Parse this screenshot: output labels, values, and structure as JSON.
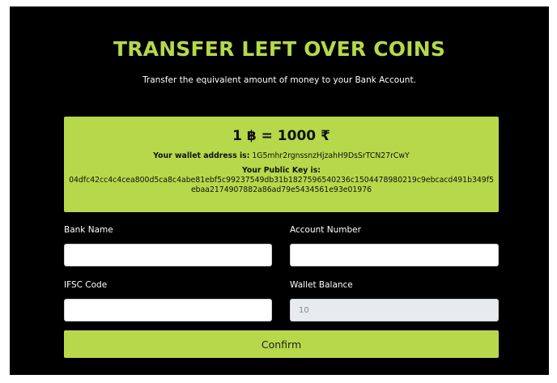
{
  "page": {
    "title": "TRANSFER LEFT OVER COINS",
    "subtitle": "Transfer the equivalent amount of money to your Bank Account."
  },
  "info": {
    "rate": "1 ฿ = 1000 ₹",
    "wallet_label": "Your wallet address is:",
    "wallet_address": "1G5mhr2rgnssnzHjzahH9DsSrTCN27rCwY",
    "public_key_label": "Your Public Key is:",
    "public_key": "04dfc42cc4c4cea800d5ca8c4abe81ebf5c99237549db31b1827596540236c1504478980219c9ebcacd491b349f5ebaa2174907882a86ad79e5434561e93e01976"
  },
  "form": {
    "bank_name_label": "Bank Name",
    "bank_name_value": "",
    "account_number_label": "Account Number",
    "account_number_value": "",
    "ifsc_label": "IFSC Code",
    "ifsc_value": "",
    "wallet_balance_label": "Wallet Balance",
    "wallet_balance_value": "10",
    "confirm_label": "Confirm"
  },
  "colors": {
    "accent": "#b7d84b",
    "background": "#000000",
    "title": "#b5d94a"
  }
}
